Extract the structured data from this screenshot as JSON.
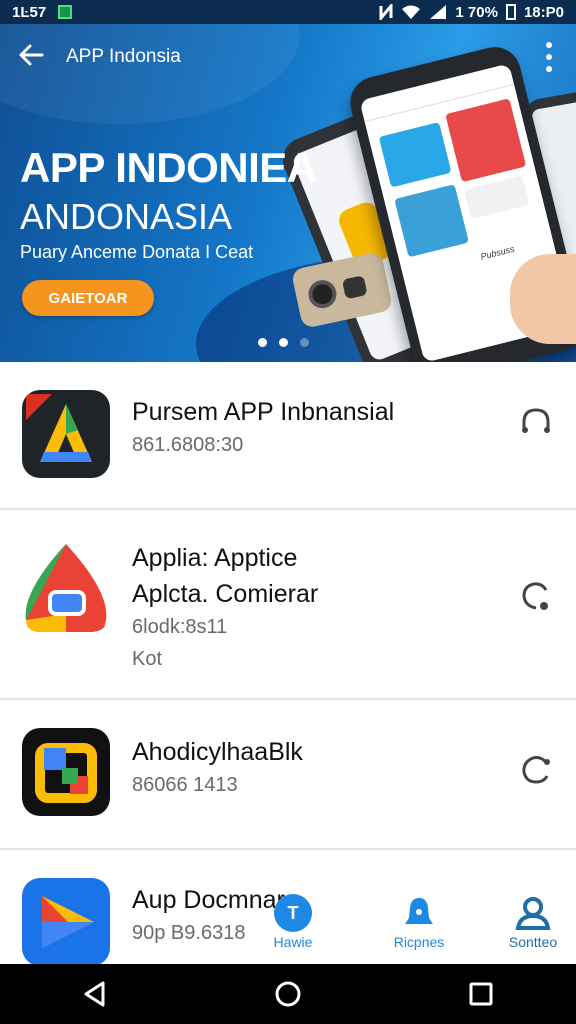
{
  "status_bar": {
    "time": "1Ŀ57",
    "battery_text": "1 70%",
    "clock_right": "18:P0",
    "icons": [
      "notification-icon",
      "nfc-icon",
      "wifi-icon",
      "signal-icon",
      "battery-icon"
    ]
  },
  "app_bar": {
    "back_icon": "arrow-left-icon",
    "title": "APP Indonsia",
    "menu_icon": "more-vertical-icon"
  },
  "hero": {
    "title": "APP INDONIEA",
    "subtitle": "ANDONASIA",
    "tagline": "Puary Anceme Donata I Ceat",
    "button_label": "GAIETOAR",
    "phone_screen_label": "Pubsuss",
    "carousel": {
      "count": 3,
      "active": 1
    },
    "colors": {
      "accent": "#f5941e",
      "background": "#1477c8"
    }
  },
  "apps": [
    {
      "name": "Pursem APP Inbnansial",
      "meta": [
        "861.6808:30"
      ],
      "icon": "app-logo-a-icon",
      "action_icon": "headphones-icon"
    },
    {
      "name": "Applia: Apptice",
      "name2": "Aplcta. Comierar",
      "meta": [
        "6lodk:8s11",
        "Kot"
      ],
      "icon": "app-logo-drop-icon",
      "action_icon": "share-icon"
    },
    {
      "name": "AhodicylhaaBlk",
      "meta": [
        "86066 1413"
      ],
      "icon": "app-logo-square-icon",
      "action_icon": "refresh-icon"
    },
    {
      "name": "Aup Docmnar",
      "meta": [
        "90p B9.6318"
      ],
      "icon": "app-logo-play-icon",
      "action_icon": ""
    }
  ],
  "bottom_tabs": [
    {
      "label": "Hawie",
      "icon": "home-icon",
      "color": "#1e88e5"
    },
    {
      "label": "Ricpnes",
      "icon": "bell-icon",
      "color": "#1e88e5"
    },
    {
      "label": "Sontteo",
      "icon": "profile-icon",
      "color": "#1e6fa8"
    }
  ],
  "system_nav": {
    "back_icon": "triangle-back-icon",
    "home_icon": "circle-home-icon",
    "recents_icon": "square-recents-icon"
  }
}
